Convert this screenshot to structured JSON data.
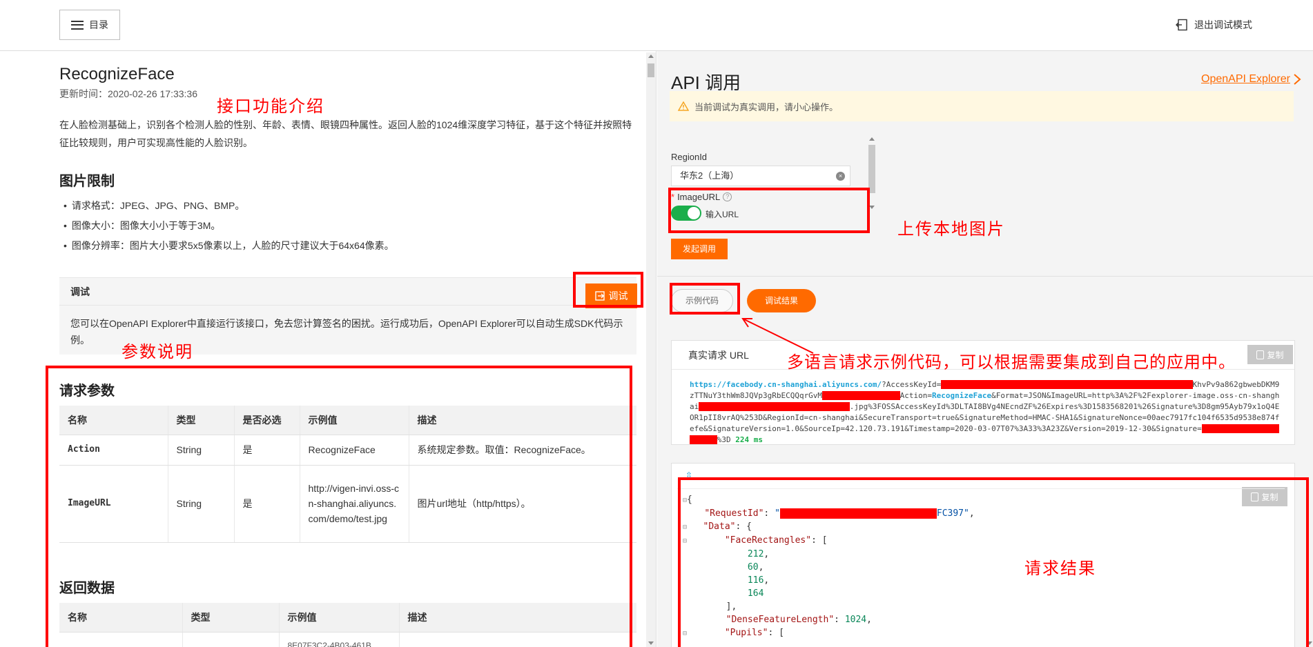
{
  "header": {
    "toc_label": "目录",
    "exit_label": "退出调试模式"
  },
  "doc": {
    "api_name": "RecognizeFace",
    "updated": "更新时间：2020-02-26 17:33:36",
    "intro": "在人脸检测基础上，识别各个检测人脸的性别、年龄、表情、眼镜四种属性。返回人脸的1024维深度学习特征，基于这个特征并按照特征比较规则，用户可实现高性能的人脸识别。",
    "image_limit_title": "图片限制",
    "image_limits": [
      "请求格式：JPEG、JPG、PNG、BMP。",
      "图像大小：图像大小小于等于3M。",
      "图像分辨率：图片大小要求5x5像素以上，人脸的尺寸建议大于64x64像素。"
    ],
    "debug_heading": "调试",
    "debug_button": "调试",
    "debug_desc": "您可以在OpenAPI Explorer中直接运行该接口，免去您计算签名的困扰。运行成功后，OpenAPI Explorer可以自动生成SDK代码示例。",
    "request_params_title": "请求参数",
    "request_columns": [
      "名称",
      "类型",
      "是否必选",
      "示例值",
      "描述"
    ],
    "request_rows": [
      [
        "Action",
        "String",
        "是",
        "RecognizeFace",
        "系统规定参数。取值：RecognizeFace。"
      ],
      [
        "ImageURL",
        "String",
        "是",
        "http://vigen-invi.oss-cn-shanghai.aliyuncs.com/demo/test.jpg",
        "图片url地址（http/https）。"
      ]
    ],
    "return_title": "返回数据",
    "return_columns": [
      "名称",
      "类型",
      "示例值",
      "描述"
    ],
    "return_partial_value": "8E07F3C2-4B03-461B"
  },
  "explorer": {
    "title": "API 调用",
    "link": "OpenAPI Explorer",
    "warning": "当前调试为真实调用，请小心操作。",
    "region_label": "RegionId",
    "region_value": "华东2（上海）",
    "imageurl_label": "ImageURL",
    "required_mark": "*",
    "toggle_label": "输入URL",
    "invoke_button": "发起调用",
    "tab_sample": "示例代码",
    "tab_result": "调试结果",
    "url_heading": "真实请求 URL",
    "copy_label": "复制",
    "url_host": "https://facebody.cn-shanghai.aliyuncs.com/",
    "url_p1": "?AccessKeyId=",
    "url_p2": "KhvPv9a862gbwebDKM9zTTNuY3thWm8JQVp3gRbECQQqrGvM",
    "url_p3": "Action=",
    "url_action": "RecognizeFace",
    "url_p4": "&Format=JSON&ImageURL=http%3A%2F%2Fexplorer-image.oss-cn-shanghai",
    "url_p5": ".jpg%3FOSSAccessKeyId%3DLTAI8BVg4NEcndZF%26Expires%3D1583568201%26Signature%3D8gm95Ayb79x1oQ4EOR1pII8vrAQ%253D&RegionId=cn-shanghai&SecureTransport=true&SignatureMethod=HMAC-SHA1&SignatureNonce=00aec7917fc104f6535d9538e874fefe&SignatureVersion=1.0&SourceIp=42.120.73.191&Timestamp=2020-03-07T07%3A33%3A23Z&Version=2019-12-30&Signature=",
    "url_p6": "%3D",
    "url_time": "224 ms",
    "json": {
      "request_id_key": "\"RequestId\"",
      "request_id_tail": "FC397\"",
      "data_key": "\"Data\"",
      "face_rect_key": "\"FaceRectangles\"",
      "rects": [
        "212",
        "60",
        "116",
        "164"
      ],
      "dense_key": "\"DenseFeatureLength\"",
      "dense_val": "1024",
      "pupils_key": "\"Pupils\""
    }
  },
  "annotations": {
    "intro": "接口功能介绍",
    "params": "参数说明",
    "upload": "上传本地图片",
    "sample": "多语言请求示例代码，可以根据需要集成到自己的应用中。",
    "result": "请求结果"
  },
  "colors": {
    "accent": "#ff6a00",
    "annotation": "#ff0000",
    "toggle_on": "#1aae4b",
    "link_blue": "#1fa2d6"
  }
}
